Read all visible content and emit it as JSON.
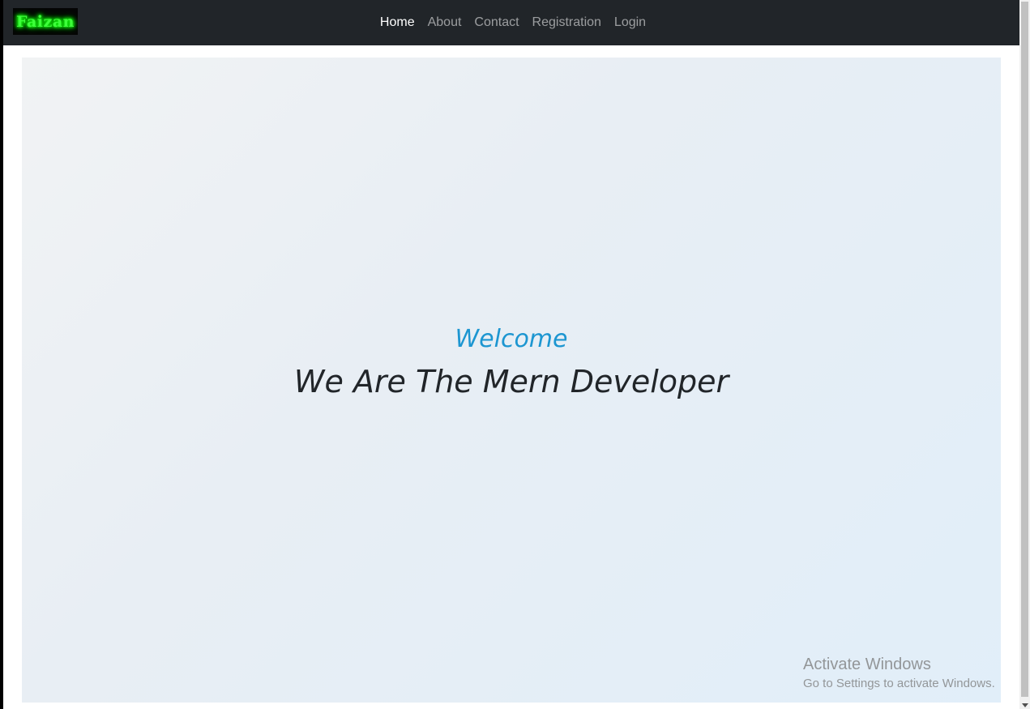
{
  "navbar": {
    "brand": "Faizan",
    "links": [
      {
        "label": "Home",
        "active": true
      },
      {
        "label": "About",
        "active": false
      },
      {
        "label": "Contact",
        "active": false
      },
      {
        "label": "Registration",
        "active": false
      },
      {
        "label": "Login",
        "active": false
      }
    ]
  },
  "hero": {
    "welcome": "Welcome",
    "tagline": "We Are The Mern Developer"
  },
  "watermark": {
    "title": "Activate Windows",
    "subtitle": "Go to Settings to activate Windows."
  },
  "colors": {
    "navbar_bg": "#212529",
    "accent": "#1d96d1",
    "text": "#212529",
    "brand_glow": "#3dff3a"
  }
}
